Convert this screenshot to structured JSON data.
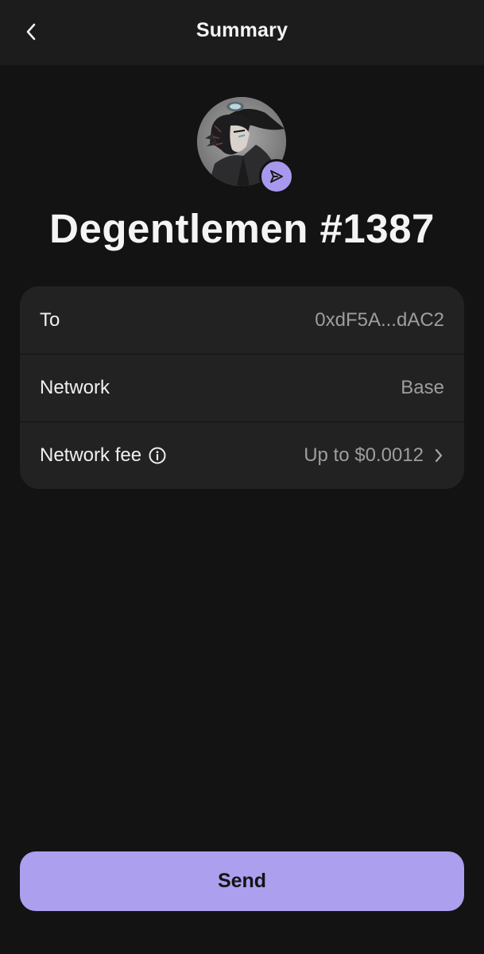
{
  "header": {
    "title": "Summary",
    "back_icon": "chevron-left-icon"
  },
  "nft": {
    "name": "Degentlemen #1387",
    "badge_icon": "send-arrow-icon"
  },
  "details": {
    "rows": [
      {
        "label": "To",
        "value": "0xdF5A...dAC2"
      },
      {
        "label": "Network",
        "value": "Base"
      },
      {
        "label": "Network fee",
        "value": "Up to $0.0012",
        "info_icon": "info-icon",
        "chevron_icon": "chevron-right-icon"
      }
    ]
  },
  "actions": {
    "send_label": "Send"
  },
  "colors": {
    "background": "#131313",
    "header": "#1c1c1c",
    "card": "#222222",
    "accent": "#ab9fee",
    "muted_text": "#9e9e9e"
  }
}
